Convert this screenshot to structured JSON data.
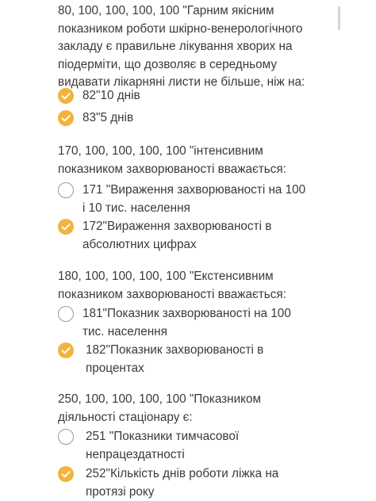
{
  "questions": [
    {
      "text": "80, 100, 100, 100, 100 \"Гарним якісним\nпоказником роботи шкірно-венерологічного\nзакладу є правильне лікування хворих на\nпіодермiти, що дозволяє в середньому\nвидавати лікарняні листи не більше, ніж на:",
      "options": [
        {
          "label": "82\"10 днів",
          "selected": true
        },
        {
          "label": "83\"5 днів",
          "selected": true
        }
      ]
    },
    {
      "text": "170, 100, 100, 100, 100 \"інтенсивним\nпоказником захворюваності вважається:",
      "options": [
        {
          "label": "171 \"Вираження захворюваності на 100\nі 10 тис. населення",
          "selected": false
        },
        {
          "label": "172\"Вираження захворюваності в\nабсолютних цифрах",
          "selected": true
        }
      ]
    },
    {
      "text": "180, 100, 100, 100, 100 \"Екстенсивним\nпоказником захворюваності вважається:",
      "options": [
        {
          "label": "181\"Показник захворюваності на 100\nтис. населення",
          "selected": false
        },
        {
          "label": "182\"Показник захворюваності в\nпроцентах",
          "selected": true
        }
      ]
    },
    {
      "text": "250, 100, 100, 100, 100 \"Показником\nдіяльності стаціонару є:",
      "options": [
        {
          "label": "251 \"Показники тимчасової\nнепрацездатності",
          "selected": false
        },
        {
          "label": "252\"Кількість днів роботи ліжка на\nпротязі року",
          "selected": true
        }
      ]
    }
  ],
  "colors": {
    "accent": "#f3b33d",
    "text": "#3a3a3a",
    "radio_border": "#9a9a9a"
  },
  "icons": {
    "selected": "check-circle-icon",
    "unselected": "empty-circle-icon"
  }
}
